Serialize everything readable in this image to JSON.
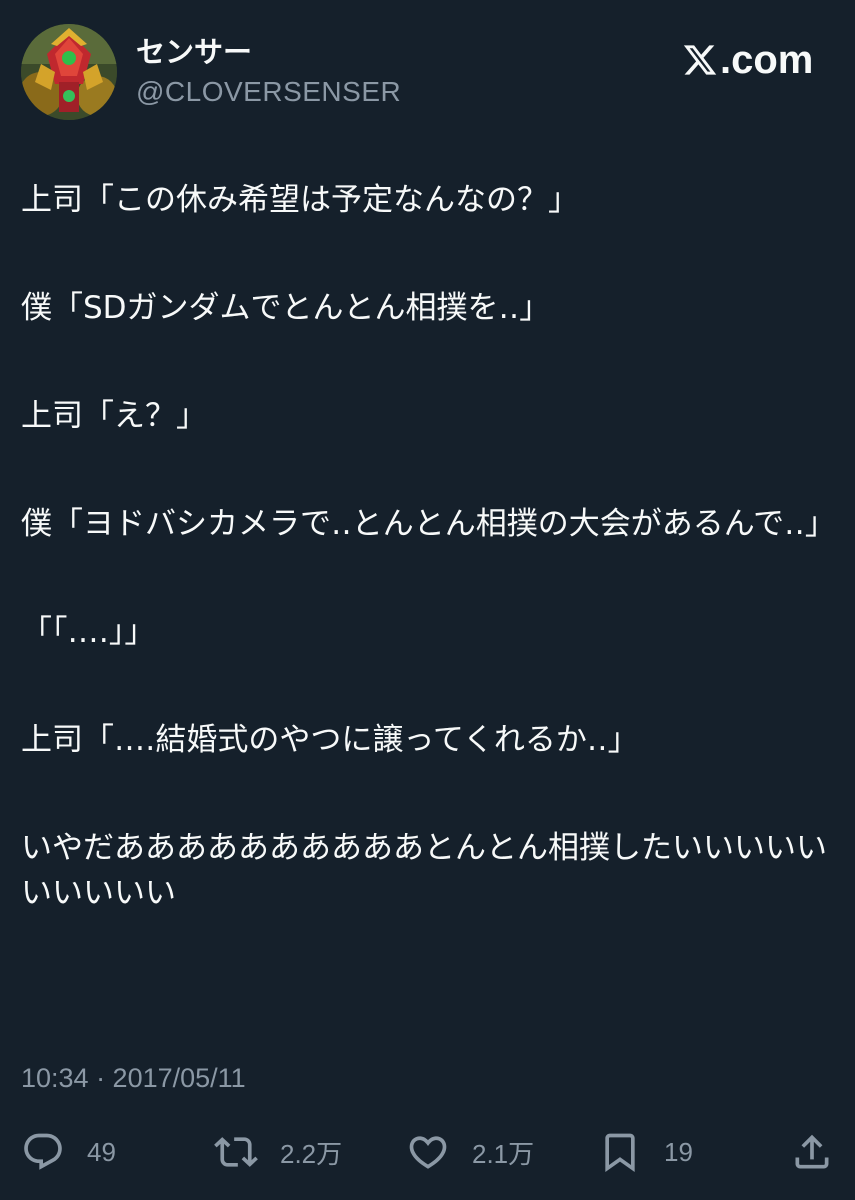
{
  "author": {
    "display_name": "センサー",
    "handle": "@CLOVERSENSER"
  },
  "brand": {
    "label": ".com"
  },
  "tweet": {
    "paragraphs": [
      "上司「この休み希望は予定なんなの？」",
      "僕「SDガンダムでとんとん相撲を‥」",
      "上司「え？」",
      "僕「ヨドバシカメラで‥とんとん相撲の大会があるんで‥」",
      "「「‥‥」」",
      "上司「‥‥結婚式のやつに譲ってくれるか‥」",
      "いやだああああああああああとんとん相撲したいいいいいいいいいい"
    ],
    "timestamp": "10:34 · 2017/05/11"
  },
  "actions": {
    "reply_count": "49",
    "retweet_count": "2.2万",
    "like_count": "2.1万",
    "bookmark_count": "19"
  },
  "icons": {
    "reply": "speech-bubble-icon",
    "retweet": "retweet-arrows-icon",
    "like": "heart-icon",
    "bookmark": "bookmark-icon",
    "share": "share-upload-icon"
  },
  "colors": {
    "background": "#15202b",
    "text_primary": "#f7f9f9",
    "text_secondary": "#8b98a5"
  }
}
